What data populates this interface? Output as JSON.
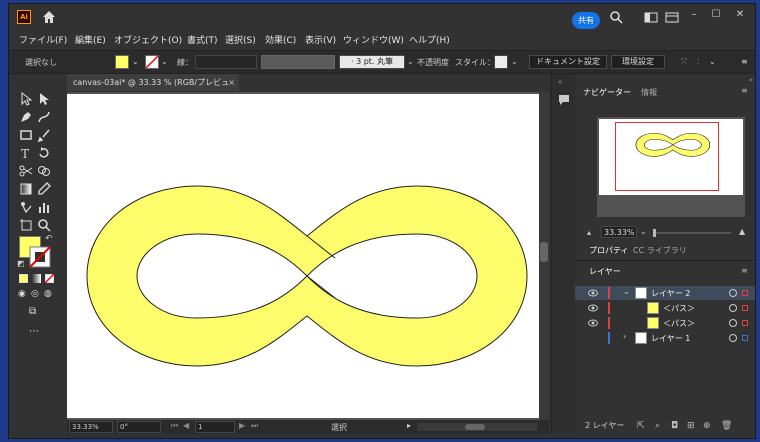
{
  "app": {
    "logo": "Ai",
    "share_label": "共有",
    "home_icon": "home-icon"
  },
  "menu": [
    "ファイル(F)",
    "編集(E)",
    "オブジェクト(O)",
    "書式(T)",
    "選択(S)",
    "効果(C)",
    "表示(V)",
    "ウィンドウ(W)",
    "ヘルプ(H)"
  ],
  "control_bar": {
    "selection_status": "選択なし",
    "fill_color": "#ffff66",
    "stroke_label": "線：",
    "brush_label": "3 pt. 丸筆",
    "opacity_label": "不透明度",
    "style_label": "スタイル：",
    "doc_settings": "ドキュメント設定",
    "prefs": "環境設定"
  },
  "document": {
    "tab_title": "canvas-03ai* @ 33.33 % (RGB/プレビュー)",
    "close_glyph": "×",
    "shape_fill": "#fdfd6b",
    "shape_stroke": "#222222"
  },
  "statusbar": {
    "zoom": "33.33%",
    "rotation": "0°",
    "artboard_num": "1",
    "status_text": "選択"
  },
  "navigator": {
    "tab_label": "ナビゲーター",
    "info_tab": "情報",
    "zoom": "33.33%"
  },
  "properties": {
    "tab_label": "プロパティ",
    "libraries_tab": "CC ライブラリ"
  },
  "layers": {
    "panel_title": "レイヤー",
    "rows": [
      {
        "name": "レイヤー 2",
        "color": "#e04040",
        "indent": 0,
        "expanded": true
      },
      {
        "name": "＜パス＞",
        "color": "#e04040",
        "indent": 1,
        "expanded": false
      },
      {
        "name": "＜パス＞",
        "color": "#e04040",
        "indent": 1,
        "expanded": false
      },
      {
        "name": "レイヤー 1",
        "color": "#4070e0",
        "indent": 0,
        "expanded": false
      }
    ],
    "count_label": "2 レイヤー"
  }
}
